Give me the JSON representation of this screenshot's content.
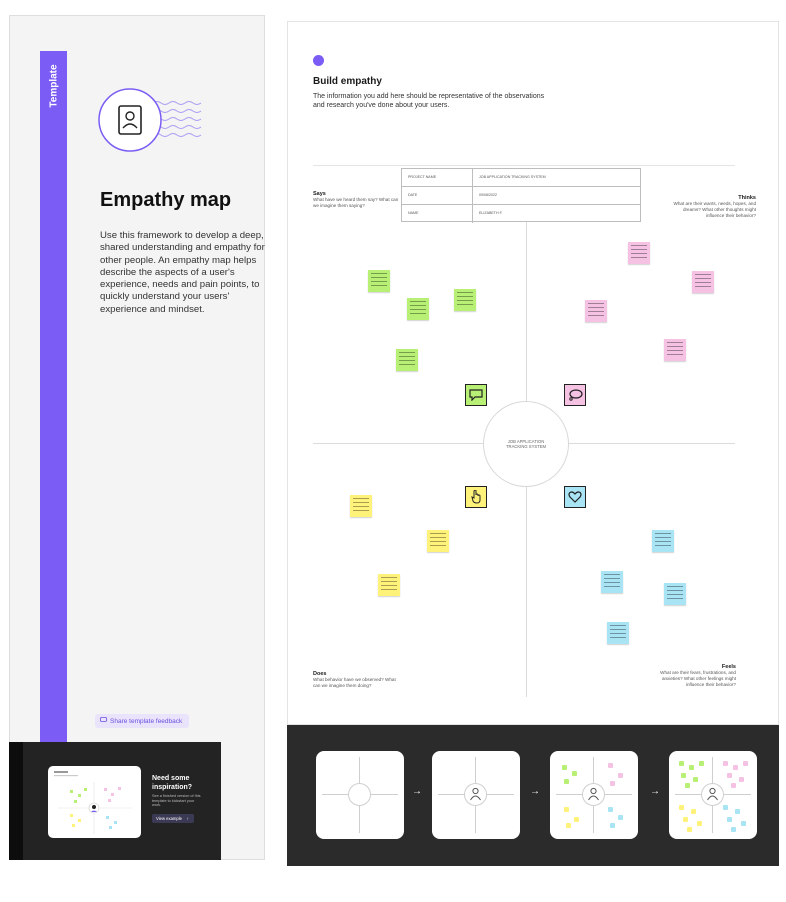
{
  "template": {
    "label": "Template",
    "title": "Empathy map",
    "description": "Use this framework to develop a deep, shared understanding and empathy for other people. An empathy map helps describe the aspects of a user's experience, needs and pain points, to quickly understand your users' experience and mindset.",
    "feedback_label": "Share template feedback"
  },
  "inspiration": {
    "title": "Need some inspiration?",
    "subtitle": "See a finished version of this template to kickstart your work.",
    "button_label": "View example"
  },
  "board": {
    "title": "Build empathy",
    "description": "The information you add here should be representative of the observations and research you've done about your users.",
    "table": [
      {
        "key": "Project name",
        "value": "Job application tracking system"
      },
      {
        "key": "Date",
        "value": "09/08/2022"
      },
      {
        "key": "Name",
        "value": "Elizabeth F."
      }
    ],
    "center_label": "Job application tracking system",
    "quadrants": {
      "says": {
        "title": "Says",
        "subtitle": "What have we heard them say? What can we imagine them saying?"
      },
      "thinks": {
        "title": "Thinks",
        "subtitle": "What are their wants, needs, hopes, and dreams? What other thoughts might influence their behavior?"
      },
      "does": {
        "title": "Does",
        "subtitle": "What behavior have we observed? What can we imagine them doing?"
      },
      "feels": {
        "title": "Feels",
        "subtitle": "What are their fears, frustrations, and anxieties? What other feelings might influence their behavior?"
      }
    }
  },
  "colors": {
    "accent": "#7b5cf5",
    "says_note": "#b7f075",
    "thinks_note": "#f6c2e3",
    "does_note": "#fff27a",
    "feels_note": "#a9e4f5"
  },
  "icons": {
    "says": "speech-bubble-icon",
    "thinks": "thought-bubble-icon",
    "does": "pointing-hand-icon",
    "feels": "heart-icon"
  }
}
